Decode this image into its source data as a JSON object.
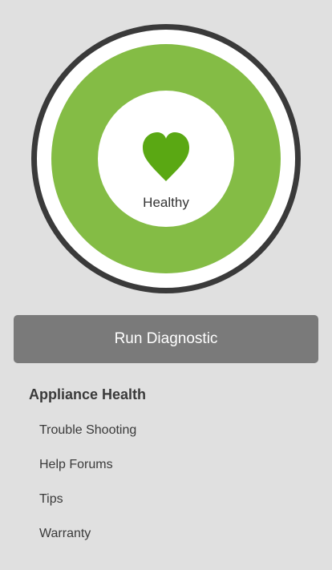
{
  "status": {
    "label": "Healthy",
    "ring_color": "#84bc45",
    "heart_color": "#5aa813",
    "icon": "heart-icon"
  },
  "actions": {
    "run_diagnostic_label": "Run Diagnostic"
  },
  "section": {
    "title": "Appliance Health",
    "items": [
      {
        "label": "Trouble Shooting"
      },
      {
        "label": "Help Forums"
      },
      {
        "label": "Tips"
      },
      {
        "label": "Warranty"
      }
    ]
  }
}
